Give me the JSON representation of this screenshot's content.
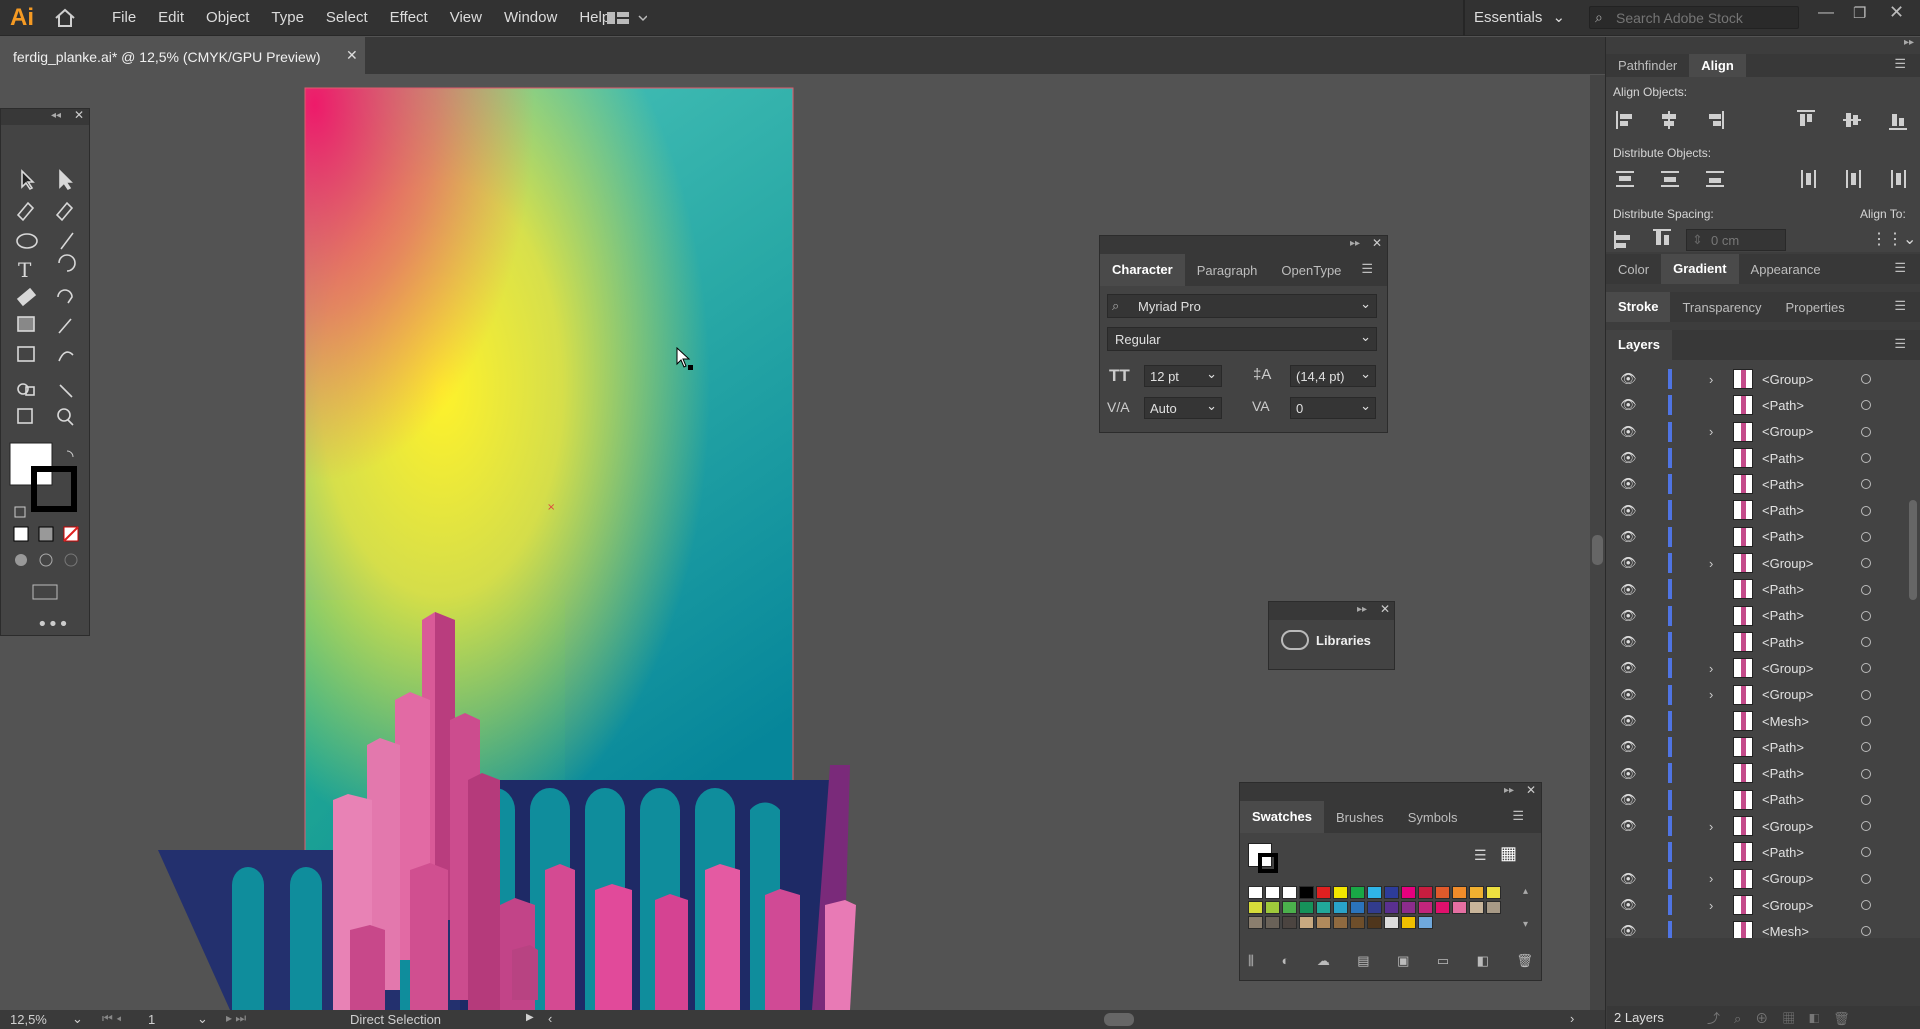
{
  "app": {
    "logo": "Ai"
  },
  "menu": [
    "File",
    "Edit",
    "Object",
    "Type",
    "Select",
    "Effect",
    "View",
    "Window",
    "Help"
  ],
  "workspace": {
    "label": "Essentials"
  },
  "search": {
    "placeholder": "Search Adobe Stock"
  },
  "document_tab": {
    "title": "ferdig_planke.ai* @ 12,5% (CMYK/GPU Preview)"
  },
  "status": {
    "zoom": "12,5%",
    "artboard": "1",
    "tool": "Direct Selection"
  },
  "character_panel": {
    "tabs": [
      "Character",
      "Paragraph",
      "OpenType"
    ],
    "font_family": "Myriad Pro",
    "font_style": "Regular",
    "font_size": "12 pt",
    "leading": "(14,4 pt)",
    "kerning": "Auto",
    "tracking": "0"
  },
  "libraries_panel": {
    "label": "Libraries"
  },
  "swatches_panel": {
    "tabs": [
      "Swatches",
      "Brushes",
      "Symbols"
    ]
  },
  "align_panel": {
    "tabs": [
      "Pathfinder",
      "Align"
    ],
    "align_objects": "Align Objects:",
    "distribute_objects": "Distribute Objects:",
    "distribute_spacing": "Distribute Spacing:",
    "align_to": "Align To:",
    "spacing_value": "0 cm"
  },
  "color_tabs": [
    "Color",
    "Gradient",
    "Appearance"
  ],
  "stroke_tabs": [
    "Stroke",
    "Transparency",
    "Properties"
  ],
  "layers_panel": {
    "title": "Layers",
    "footer": "2 Layers",
    "rows": [
      {
        "name": "<Group>",
        "expand": true
      },
      {
        "name": "<Path>",
        "expand": false
      },
      {
        "name": "<Group>",
        "expand": true
      },
      {
        "name": "<Path>",
        "expand": false
      },
      {
        "name": "<Path>",
        "expand": false
      },
      {
        "name": "<Path>",
        "expand": false
      },
      {
        "name": "<Path>",
        "expand": false
      },
      {
        "name": "<Group>",
        "expand": true
      },
      {
        "name": "<Path>",
        "expand": false
      },
      {
        "name": "<Path>",
        "expand": false
      },
      {
        "name": "<Path>",
        "expand": false
      },
      {
        "name": "<Group>",
        "expand": true
      },
      {
        "name": "<Group>",
        "expand": true
      },
      {
        "name": "<Mesh>",
        "expand": false
      },
      {
        "name": "<Path>",
        "expand": false
      },
      {
        "name": "<Path>",
        "expand": false
      },
      {
        "name": "<Path>",
        "expand": false
      },
      {
        "name": "<Group>",
        "expand": true
      },
      {
        "name": "<Path>",
        "expand": false
      },
      {
        "name": "<Group>",
        "expand": true
      },
      {
        "name": "<Group>",
        "expand": true
      },
      {
        "name": "<Mesh>",
        "expand": false
      }
    ]
  },
  "colors": {
    "accent": "#f59a23",
    "layer_bar": "#4f74e3",
    "artboard_border": "#e05b6e"
  }
}
